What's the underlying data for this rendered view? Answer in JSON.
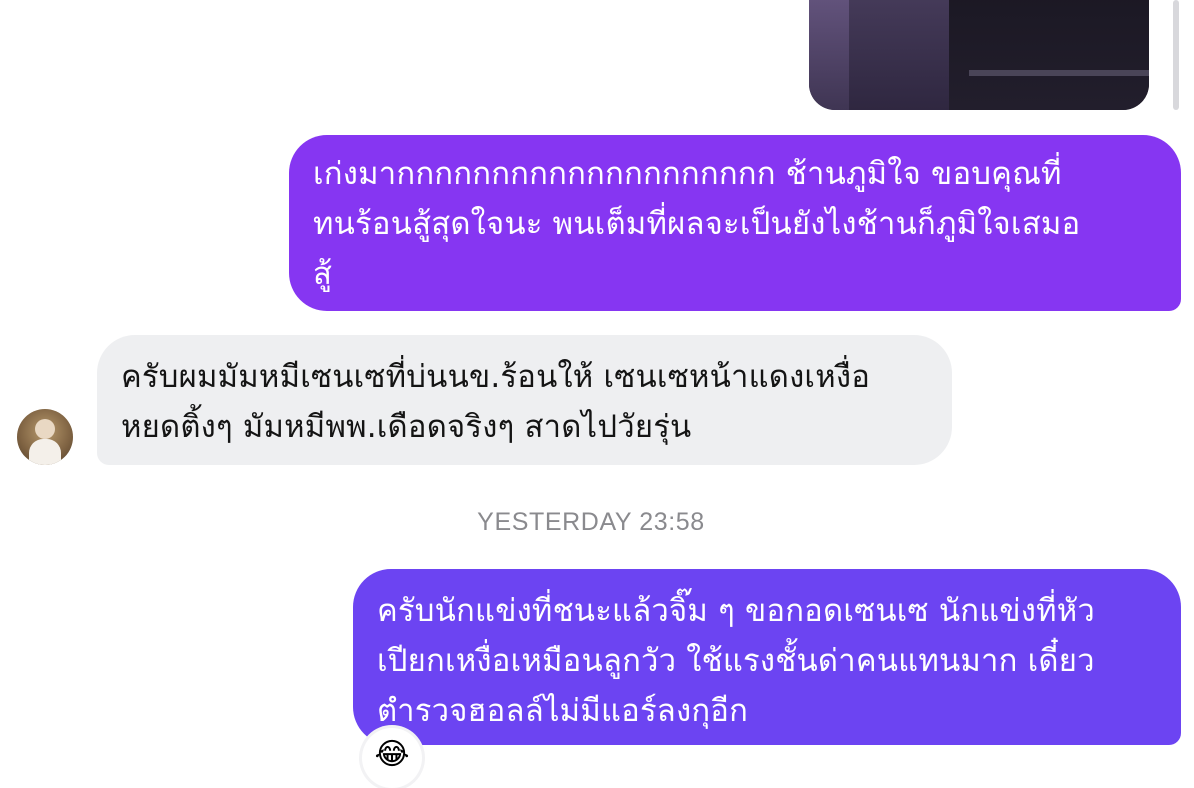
{
  "messages": {
    "outgoing_1": {
      "lines": [
        "เก่งมากกกกกกกกกกกกกกกกกกกก ช้านภูมิใจ ขอบคุณที่",
        "ทนร้อนสู้สุดใจนะ พนเต็มที่ผลจะเป็นยังไงช้านก็ภูมิใจเสมอ",
        "สู้"
      ]
    },
    "incoming_1": {
      "lines": [
        "ครับผมมัมหมีเซนเซที่บ่นนข.ร้อนให้ เซนเซหน้าแดงเหงื่อ",
        "หยดติ้งๆ มัมหมีพพ.เดือดจริงๆ สาดไปวัยรุ่น"
      ]
    },
    "timestamp": "YESTERDAY 23:58",
    "outgoing_2": {
      "lines": [
        "ครับนักแข่งที่ชนะแล้วจิ๊ม ๆ ขอกอดเซนเซ นักแข่งที่หัว",
        "เปียกเหงื่อเหมือนลูกวัว ใช้แรงชั้นด่าคนแทนมาก เดี๋ยว",
        "ตำรวจฮอลล์ไม่มีแอร์ลงกุอีก"
      ],
      "reaction": "😂"
    }
  },
  "colors": {
    "outgoing_bubble_top": "#8636f2",
    "outgoing_bubble_bottom": "#6c44f2",
    "incoming_bubble": "#eeeff1",
    "timestamp_text": "#8a8a8e"
  },
  "icons": {
    "reaction": "face-with-tears-of-joy-icon",
    "avatar": "user-avatar"
  }
}
